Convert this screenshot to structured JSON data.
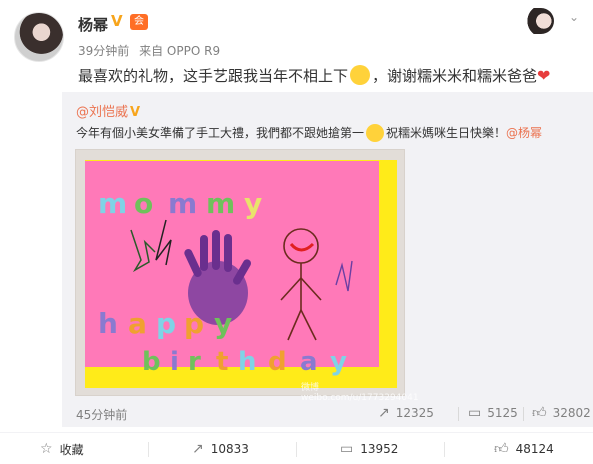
{
  "post": {
    "author": "杨幂",
    "verified_badge": "V",
    "member_badge": "会",
    "time": "39分钟前",
    "source": "来自 OPPO R9",
    "text_part1": "最喜欢的礼物，这手艺跟我当年不相上下",
    "text_part2": "，谢谢糯米米和糯米爸爸",
    "heart": "❤"
  },
  "repost": {
    "author": "@刘恺威",
    "verified_badge": "V",
    "text_part1": "今年有個小美女準備了手工大禮，我們都不跟她搶第一",
    "text_part2": "祝糯米媽咪生日快樂！",
    "mention": "@杨幂",
    "photo": {
      "letters_line1": [
        "m",
        "o",
        "m",
        "m",
        "y"
      ],
      "letters_line2": [
        "h",
        "a",
        "p",
        "p",
        "y"
      ],
      "letters_line3": [
        "b",
        "i",
        "r",
        "t",
        "h",
        "d",
        "a",
        "y"
      ],
      "watermark": "微博 weibo.com/u/1773294041",
      "card_color": "#ff79b8",
      "border_color": "#ffeb19"
    },
    "time": "45分钟前",
    "forward_count": "12325",
    "comment_count": "5125",
    "like_count": "32802"
  },
  "actions": {
    "favorite_label": "收藏",
    "forward_count": "10833",
    "comment_count": "13952",
    "like_count": "48124"
  },
  "icons": {
    "forward": "forward-icon",
    "comment": "comment-icon",
    "like": "thumbs-up-icon",
    "favorite": "star-icon",
    "chevron": "chevron-down-icon"
  },
  "colors": {
    "accent": "#eb7350",
    "verify": "#f7a51c",
    "repost_bg": "#f2f2f5"
  }
}
